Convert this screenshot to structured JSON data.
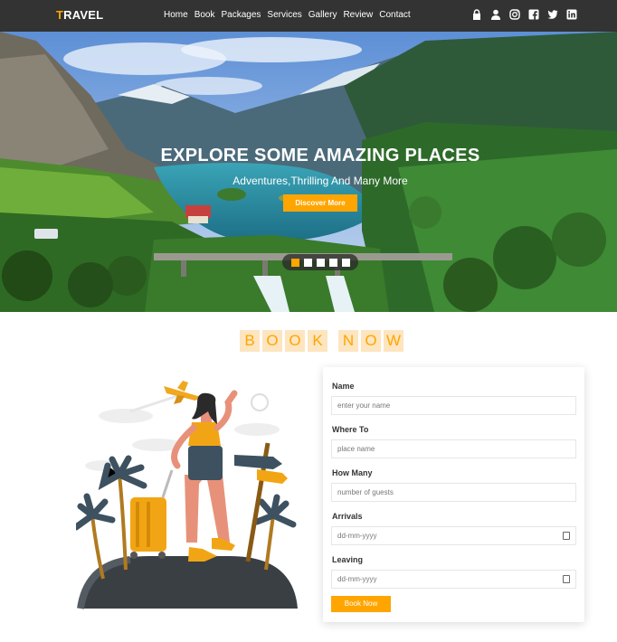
{
  "nav": {
    "logo_first": "T",
    "logo_rest": "RAVEL",
    "menu": [
      "Home",
      "Book",
      "Packages",
      "Services",
      "Gallery",
      "Review",
      "Contact"
    ],
    "icons": [
      "lock-icon",
      "user-icon",
      "instagram-icon",
      "facebook-icon",
      "twitter-icon",
      "linkedin-icon"
    ]
  },
  "hero": {
    "title": "EXPLORE SOME AMAZING PLACES",
    "subtitle": "Adventures,Thrilling And Many More",
    "button": "Discover More",
    "slides": 5,
    "active_slide": 1
  },
  "book": {
    "heading_letters": [
      "B",
      "O",
      "O",
      "K",
      "",
      "N",
      "O",
      "W"
    ],
    "fields": {
      "name_label": "Name",
      "name_placeholder": "enter your name",
      "where_label": "Where To",
      "where_placeholder": "place name",
      "howmany_label": "How Many",
      "howmany_placeholder": "number of guests",
      "arrivals_label": "Arrivals",
      "arrivals_value": "dd-mm-yyyy",
      "leaving_label": "Leaving",
      "leaving_value": "dd-mm-yyyy"
    },
    "submit": "Book Now"
  },
  "colors": {
    "accent": "#ffa500",
    "nav_bg": "#333333",
    "heading_bg": "#fde5c0"
  }
}
